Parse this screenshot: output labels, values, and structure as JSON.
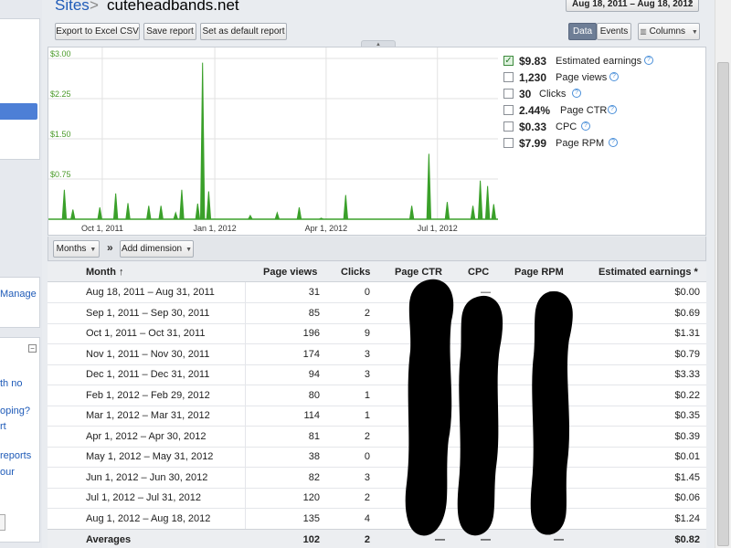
{
  "breadcrumb": {
    "root": "Sites",
    "separator": ">",
    "current": "cuteheadbands.net"
  },
  "date_range": {
    "label": "Aug 18, 2011 – Aug 18, 2012"
  },
  "toolbar": {
    "export_csv": "Export to Excel CSV",
    "save_report": "Save report",
    "set_default": "Set as default report",
    "view_data": "Data",
    "view_events": "Events",
    "columns": "Columns"
  },
  "left_sidebar": {
    "links": [
      "Manage",
      "th no",
      "oping?",
      "rt",
      "reports",
      "our"
    ]
  },
  "legend": [
    {
      "value": "$9.83",
      "label": "Estimated earnings",
      "checked": true
    },
    {
      "value": "1,230",
      "label": "Page views",
      "checked": false
    },
    {
      "value": "30",
      "label": "Clicks",
      "checked": false
    },
    {
      "value": "2.44%",
      "label": "Page CTR",
      "checked": false
    },
    {
      "value": "$0.33",
      "label": "CPC",
      "checked": false
    },
    {
      "value": "$7.99",
      "label": "Page RPM",
      "checked": false
    }
  ],
  "chart_data": {
    "type": "line",
    "title": "",
    "ylim": [
      0,
      3.0
    ],
    "y_ticks": [
      "$0.75",
      "$1.50",
      "$2.25",
      "$3.00"
    ],
    "x_ticks": [
      "Oct 1, 2011",
      "Jan 1, 2012",
      "Apr 1, 2012",
      "Jul 1, 2012"
    ],
    "x_range": [
      "2011-08-18",
      "2012-08-18"
    ],
    "grid": true,
    "color": "#3aa02a",
    "series": [
      {
        "points": [
          [
            "2011-08-31",
            0.55
          ],
          [
            "2011-09-07",
            0.18
          ],
          [
            "2011-09-29",
            0.22
          ],
          [
            "2011-10-12",
            0.48
          ],
          [
            "2011-10-22",
            0.3
          ],
          [
            "2011-11-08",
            0.25
          ],
          [
            "2011-11-18",
            0.25
          ],
          [
            "2011-11-30",
            0.12
          ],
          [
            "2011-12-05",
            0.55
          ],
          [
            "2011-12-18",
            0.29
          ],
          [
            "2011-12-22",
            2.92
          ],
          [
            "2011-12-27",
            0.52
          ],
          [
            "2012-01-30",
            0.07
          ],
          [
            "2012-02-21",
            0.12
          ],
          [
            "2012-03-10",
            0.22
          ],
          [
            "2012-03-28",
            0.02
          ],
          [
            "2012-04-17",
            0.45
          ],
          [
            "2012-06-10",
            0.25
          ],
          [
            "2012-06-24",
            1.22
          ],
          [
            "2012-07-09",
            0.32
          ],
          [
            "2012-07-30",
            0.25
          ],
          [
            "2012-08-05",
            0.72
          ],
          [
            "2012-08-11",
            0.62
          ],
          [
            "2012-08-16",
            0.28
          ]
        ]
      }
    ]
  },
  "dimension_bar": {
    "period": "Months",
    "add_dimension": "Add dimension",
    "chevron": "»"
  },
  "table": {
    "columns": [
      "Month",
      "Page views",
      "Clicks",
      "Page CTR",
      "CPC",
      "Page RPM",
      "Estimated earnings *"
    ],
    "sort_indicator": "↑",
    "rows": [
      [
        "Aug 18, 2011 – Aug 31, 2011",
        "31",
        "0",
        "",
        "—",
        "",
        "$0.00"
      ],
      [
        "Sep 1, 2011 – Sep 30, 2011",
        "85",
        "2",
        "",
        "",
        "",
        "$0.69"
      ],
      [
        "Oct 1, 2011 – Oct 31, 2011",
        "196",
        "9",
        "",
        "",
        "",
        "$1.31"
      ],
      [
        "Nov 1, 2011 – Nov 30, 2011",
        "174",
        "3",
        "",
        "",
        "",
        "$0.79"
      ],
      [
        "Dec 1, 2011 – Dec 31, 2011",
        "94",
        "3",
        "",
        "",
        "",
        "$3.33"
      ],
      [
        "Feb 1, 2012 – Feb 29, 2012",
        "80",
        "1",
        "",
        "",
        "",
        "$0.22"
      ],
      [
        "Mar 1, 2012 – Mar 31, 2012",
        "114",
        "1",
        "",
        "",
        "",
        "$0.35"
      ],
      [
        "Apr 1, 2012 – Apr 30, 2012",
        "81",
        "2",
        "",
        "",
        "",
        "$0.39"
      ],
      [
        "May 1, 2012 – May 31, 2012",
        "38",
        "0",
        "",
        "",
        "",
        "$0.01"
      ],
      [
        "Jun 1, 2012 – Jun 30, 2012",
        "82",
        "3",
        "",
        "",
        "",
        "$1.45"
      ],
      [
        "Jul 1, 2012 – Jul 31, 2012",
        "120",
        "2",
        "",
        "",
        "",
        "$0.06"
      ],
      [
        "Aug 1, 2012 – Aug 18, 2012",
        "135",
        "4",
        "",
        "",
        "",
        "$1.24"
      ]
    ],
    "averages": [
      "Averages",
      "102",
      "2",
      "—",
      "—",
      "—",
      "$0.82"
    ]
  }
}
